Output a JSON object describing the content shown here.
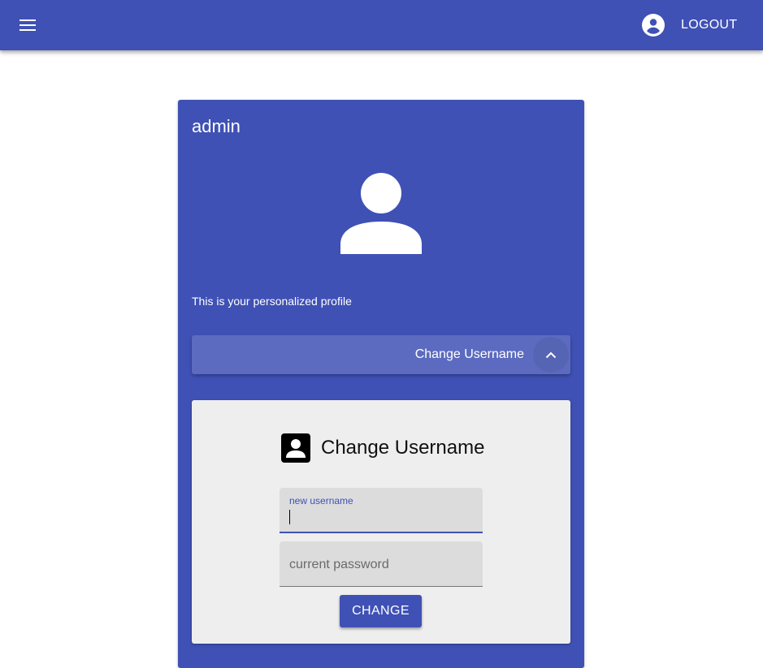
{
  "appbar": {
    "menu_icon": "menu-icon",
    "account_icon": "account-circle-icon",
    "logout_label": "LOGOUT"
  },
  "profile": {
    "username": "admin",
    "avatar_icon": "person-icon",
    "description": "This is your personalized profile"
  },
  "expansion": {
    "title": "Change Username",
    "toggle_icon": "chevron-up-icon",
    "expanded": true
  },
  "form": {
    "heading_icon": "account-box-icon",
    "heading": "Change Username",
    "new_username_label": "new username",
    "new_username_value": "",
    "current_password_placeholder": "current password",
    "submit_label": "CHANGE"
  },
  "colors": {
    "primary": "#3f51b5",
    "primary_light": "#5c6bc0",
    "panel_bg": "#eeeeee",
    "field_bg": "#dcdcdc"
  }
}
